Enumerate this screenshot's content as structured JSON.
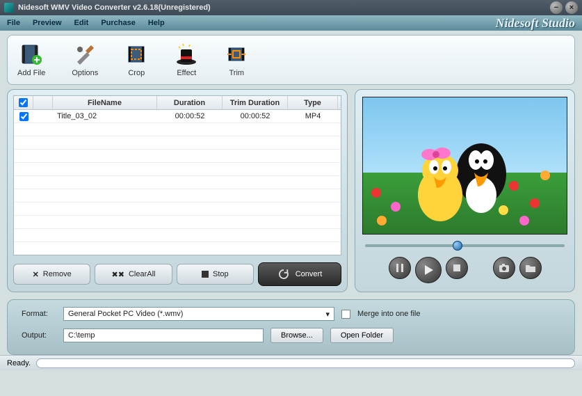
{
  "window": {
    "title": "Nidesoft WMV Video Converter v2.6.18(Unregistered)"
  },
  "menu": {
    "file": "File",
    "preview": "Preview",
    "edit": "Edit",
    "purchase": "Purchase",
    "help": "Help",
    "brand": "Nidesoft Studio"
  },
  "toolbar": {
    "addfile": "Add File",
    "options": "Options",
    "crop": "Crop",
    "effect": "Effect",
    "trim": "Trim"
  },
  "table": {
    "headers": {
      "filename": "FileName",
      "duration": "Duration",
      "trimduration": "Trim Duration",
      "type": "Type"
    },
    "rows": [
      {
        "checked": true,
        "name": "Title_03_02",
        "duration": "00:00:52",
        "trimduration": "00:00:52",
        "type": "MP4"
      }
    ]
  },
  "actions": {
    "remove": "Remove",
    "clearall": "ClearAll",
    "stop": "Stop",
    "convert": "Convert"
  },
  "format_row": {
    "label": "Format:",
    "value": "General Pocket PC Video (*.wmv)",
    "merge": "Merge into one file"
  },
  "output_row": {
    "label": "Output:",
    "value": "C:\\temp",
    "browse": "Browse...",
    "openfolder": "Open Folder"
  },
  "status": {
    "text": "Ready."
  }
}
